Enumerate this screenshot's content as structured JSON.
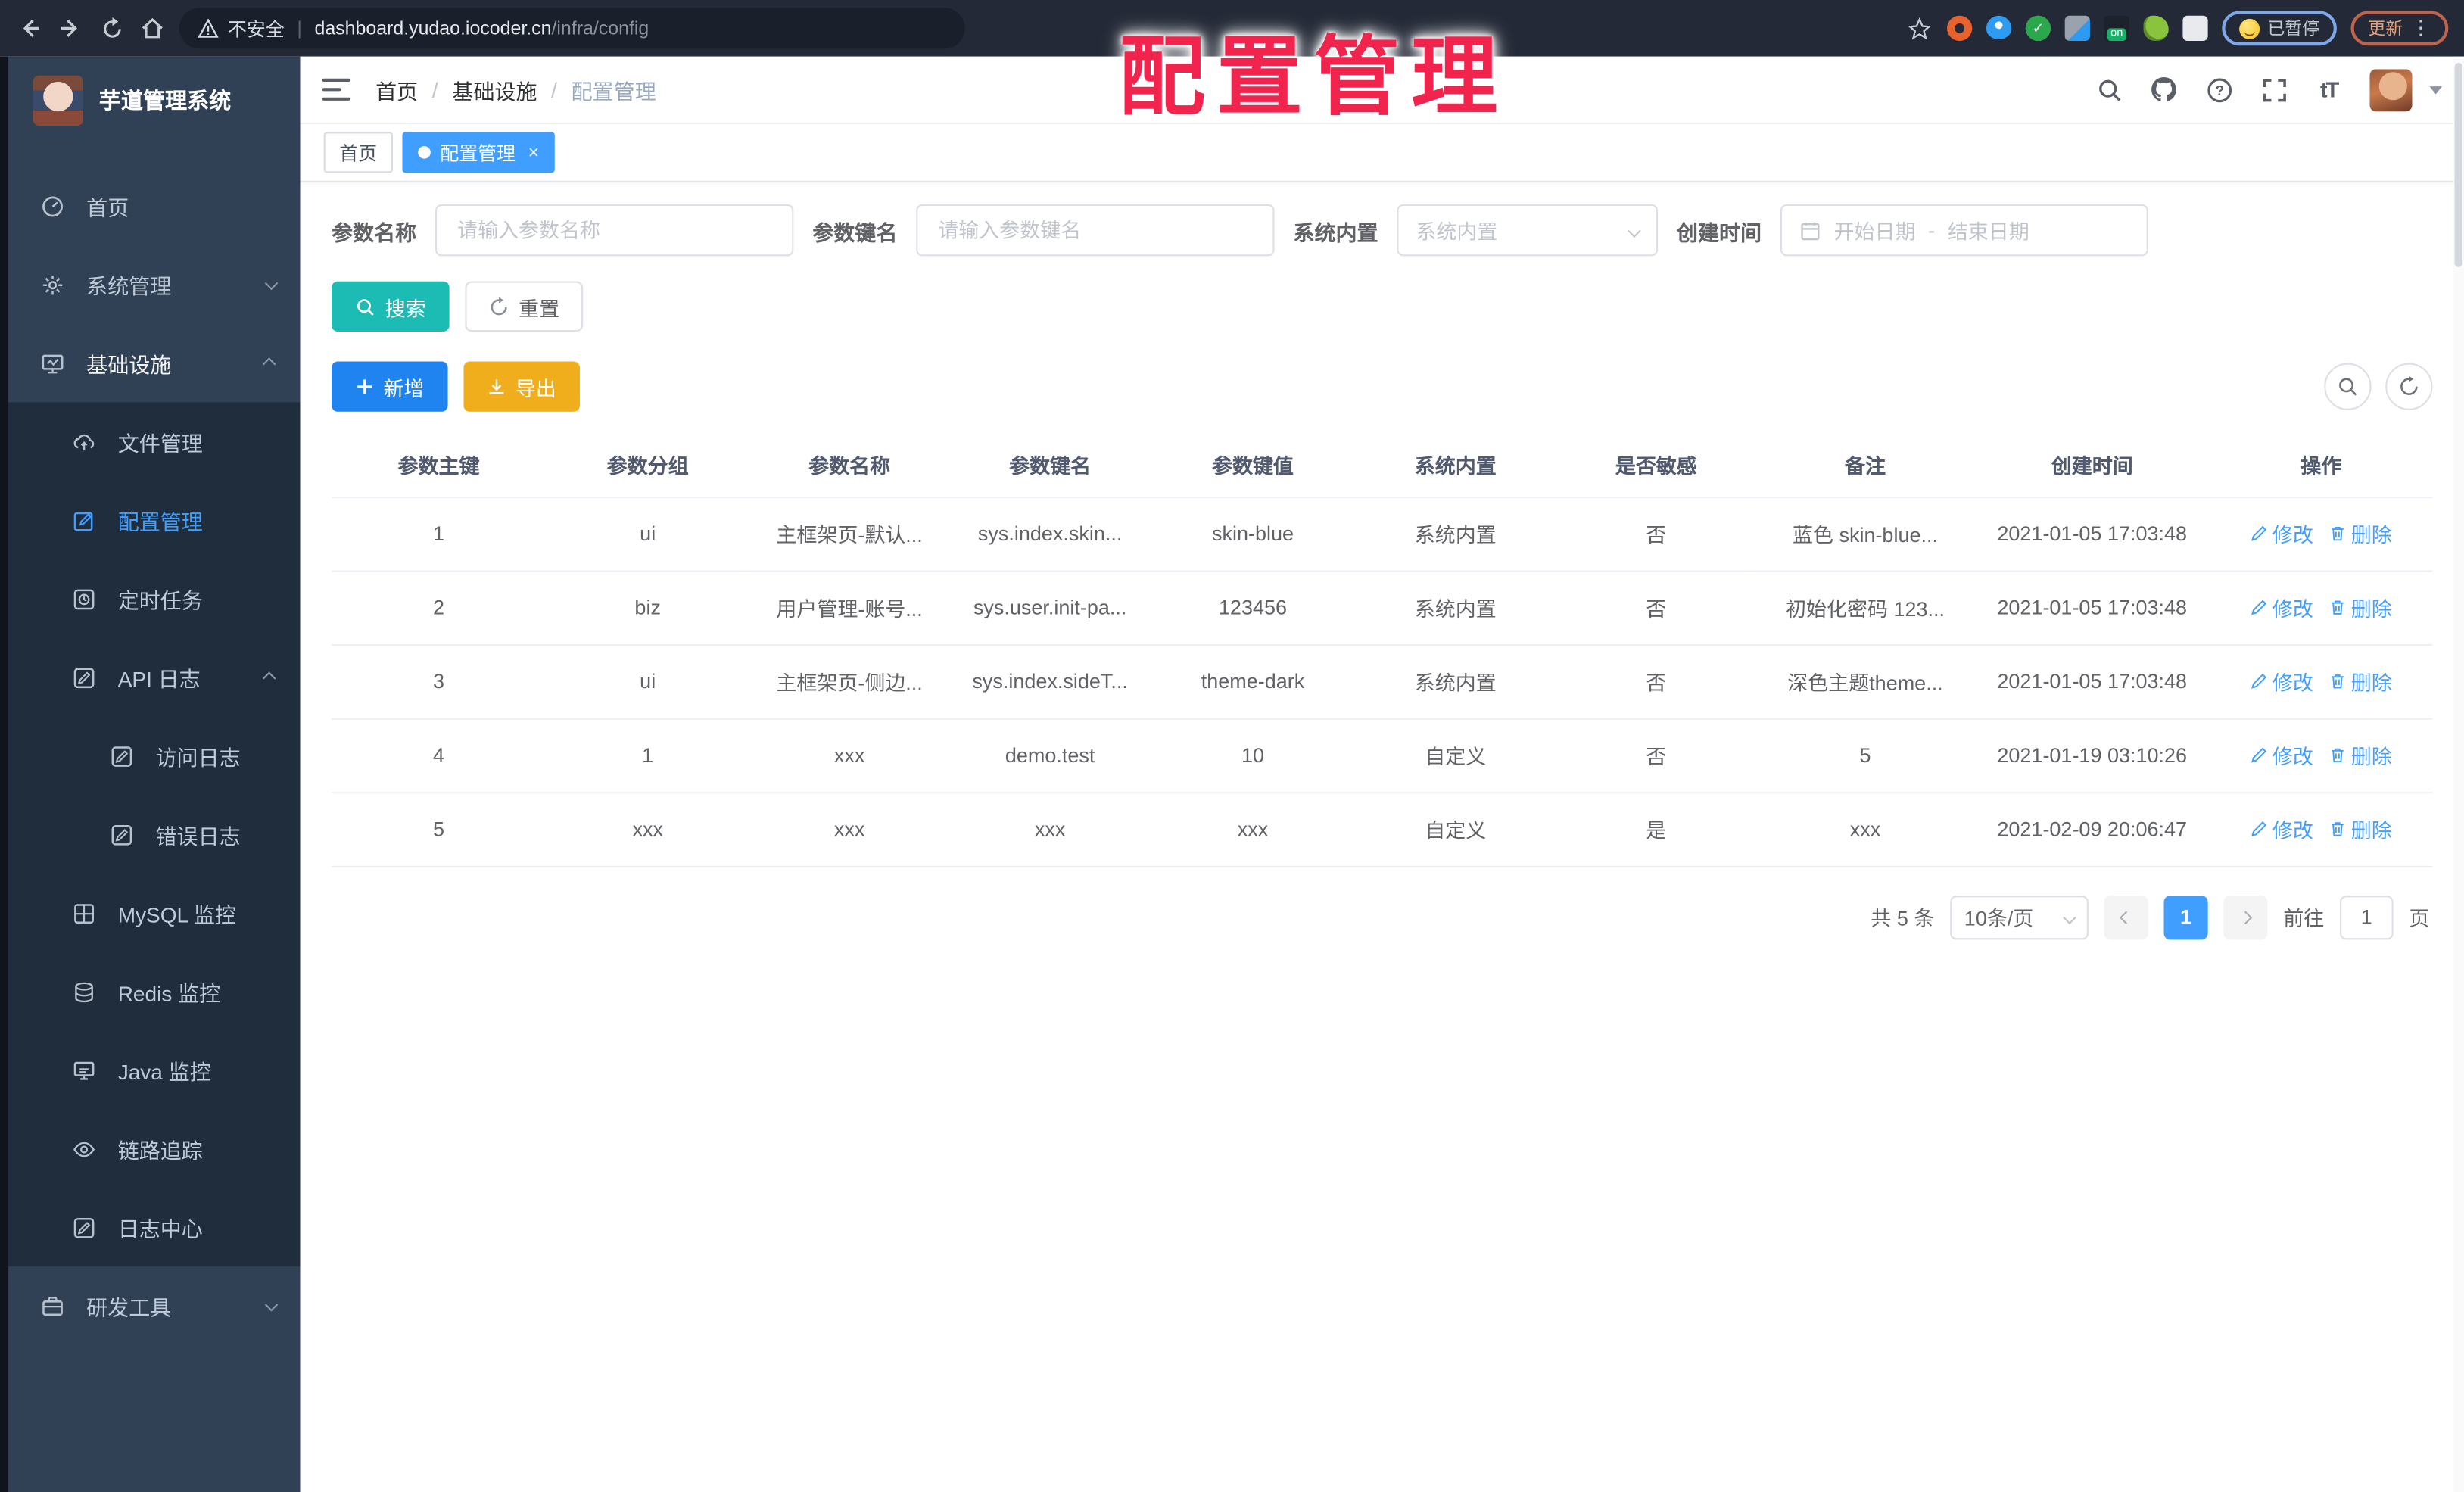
{
  "colors": {
    "primary": "#409EFF",
    "teal": "#1CBBB4",
    "warning": "#F0AD1C",
    "sidebar_bg": "#304156",
    "submenu_bg": "#1F2D3D",
    "annotation_red": "#F1244D"
  },
  "annotation": {
    "text": "配置管理"
  },
  "browser": {
    "security_label": "不安全",
    "url_host": "dashboard.yudao.iocoder.cn",
    "url_path": "/infra/config",
    "paused_button": "已暂停",
    "update_button": "更新",
    "extension_on_badge": "on"
  },
  "sidebar": {
    "logo_title": "芋道管理系统",
    "items": [
      {
        "label": "首页"
      },
      {
        "label": "系统管理"
      },
      {
        "label": "基础设施"
      },
      {
        "label": "文件管理"
      },
      {
        "label": "配置管理"
      },
      {
        "label": "定时任务"
      },
      {
        "label": "API 日志"
      },
      {
        "label": "访问日志"
      },
      {
        "label": "错误日志"
      },
      {
        "label": "MySQL 监控"
      },
      {
        "label": "Redis 监控"
      },
      {
        "label": "Java 监控"
      },
      {
        "label": "链路追踪"
      },
      {
        "label": "日志中心"
      },
      {
        "label": "研发工具"
      }
    ]
  },
  "header": {
    "breadcrumb": [
      "首页",
      "基础设施",
      "配置管理"
    ],
    "breadcrumb_separator": "/"
  },
  "tabs": [
    {
      "label": "首页"
    },
    {
      "label": "配置管理",
      "close": "×"
    }
  ],
  "filters": {
    "name_label": "参数名称",
    "name_placeholder": "请输入参数名称",
    "key_label": "参数键名",
    "key_placeholder": "请输入参数键名",
    "type_label": "系统内置",
    "type_placeholder": "系统内置",
    "date_label": "创建时间",
    "date_start": "开始日期",
    "date_separator": "-",
    "date_end": "结束日期"
  },
  "actions": {
    "search": "搜索",
    "reset": "重置",
    "add": "新增",
    "export": "导出"
  },
  "table": {
    "columns": [
      "参数主键",
      "参数分组",
      "参数名称",
      "参数键名",
      "参数键值",
      "系统内置",
      "是否敏感",
      "备注",
      "创建时间",
      "操作"
    ],
    "rows": [
      {
        "cells": [
          "1",
          "ui",
          "主框架页-默认...",
          "sys.index.skin...",
          "skin-blue",
          "系统内置",
          "否",
          "蓝色 skin-blue...",
          "2021-01-05 17:03:48"
        ]
      },
      {
        "cells": [
          "2",
          "biz",
          "用户管理-账号...",
          "sys.user.init-pa...",
          "123456",
          "系统内置",
          "否",
          "初始化密码 123...",
          "2021-01-05 17:03:48"
        ]
      },
      {
        "cells": [
          "3",
          "ui",
          "主框架页-侧边...",
          "sys.index.sideT...",
          "theme-dark",
          "系统内置",
          "否",
          "深色主题theme...",
          "2021-01-05 17:03:48"
        ]
      },
      {
        "cells": [
          "4",
          "1",
          "xxx",
          "demo.test",
          "10",
          "自定义",
          "否",
          "5",
          "2021-01-19 03:10:26"
        ]
      },
      {
        "cells": [
          "5",
          "xxx",
          "xxx",
          "xxx",
          "xxx",
          "自定义",
          "是",
          "xxx",
          "2021-02-09 20:06:47"
        ]
      }
    ],
    "row_actions": {
      "edit": "修改",
      "delete": "删除"
    }
  },
  "pagination": {
    "total": "共 5 条",
    "page_size": "10条/页",
    "current_page": "1",
    "goto_label": "前往",
    "goto_value": "1",
    "goto_suffix": "页"
  }
}
